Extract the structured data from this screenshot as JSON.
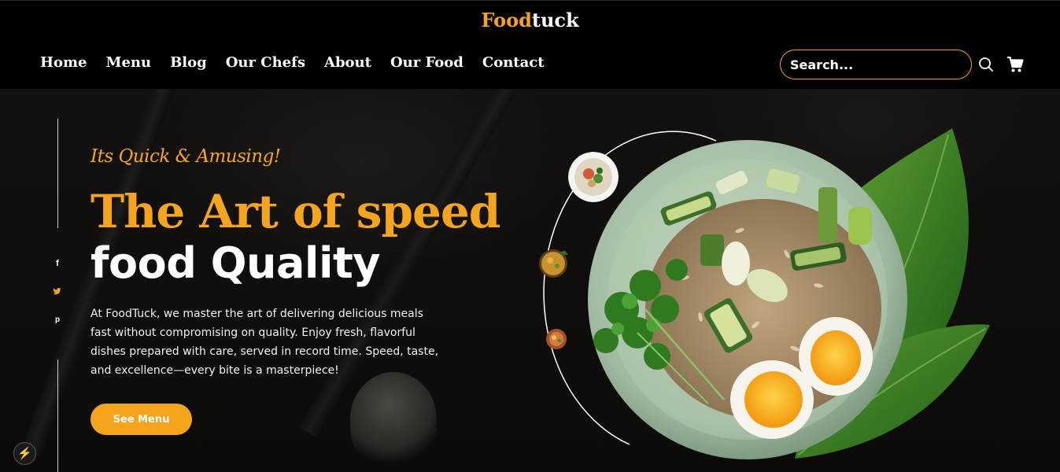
{
  "header": {
    "logo_part1": "Food",
    "logo_part2": "tuck",
    "nav": [
      "Home",
      "Menu",
      "Blog",
      "Our Chefs",
      "About",
      "Our Food",
      "Contact"
    ],
    "search_placeholder": "Search..."
  },
  "social": {
    "facebook": "f",
    "pinterest": "p"
  },
  "hero": {
    "tagline": "Its Quick & Amusing!",
    "title_line1": "The Art of speed",
    "title_line2": "food Quality",
    "description": "At FoodTuck, we master the art of delivering delicious meals fast without compromising on quality. Enjoy fresh, flavorful dishes prepared with care, served in record time. Speed, taste, and excellence—every bite is a masterpiece!",
    "button_label": "See Menu"
  },
  "colors": {
    "accent": "#f7a41d",
    "background": "#000000",
    "text": "#ffffff"
  },
  "icons": [
    "search-icon",
    "cart-icon",
    "facebook-icon",
    "twitter-icon",
    "pinterest-icon",
    "bolt-icon"
  ]
}
